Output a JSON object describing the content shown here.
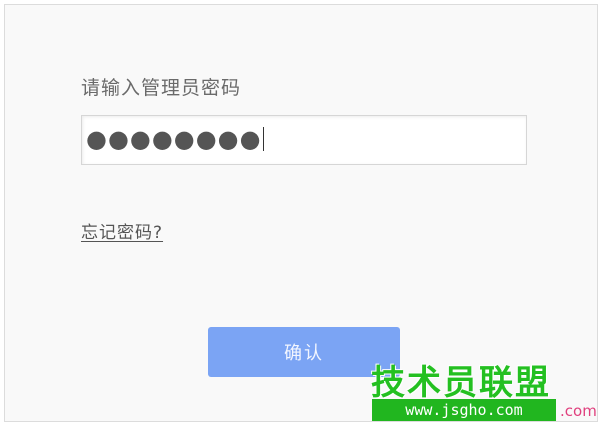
{
  "login": {
    "prompt": "请输入管理员密码",
    "password_value": "●●●●●●●●",
    "forgot_link": "忘记密码?",
    "confirm_button": "确认"
  },
  "watermark": {
    "title": "技术员联盟",
    "url": "www.jsgho.com",
    "url_suffix": ".com"
  },
  "colors": {
    "button": "#7ba4f4",
    "watermark_green": "#24c021",
    "watermark_pink": "#e0407e"
  }
}
